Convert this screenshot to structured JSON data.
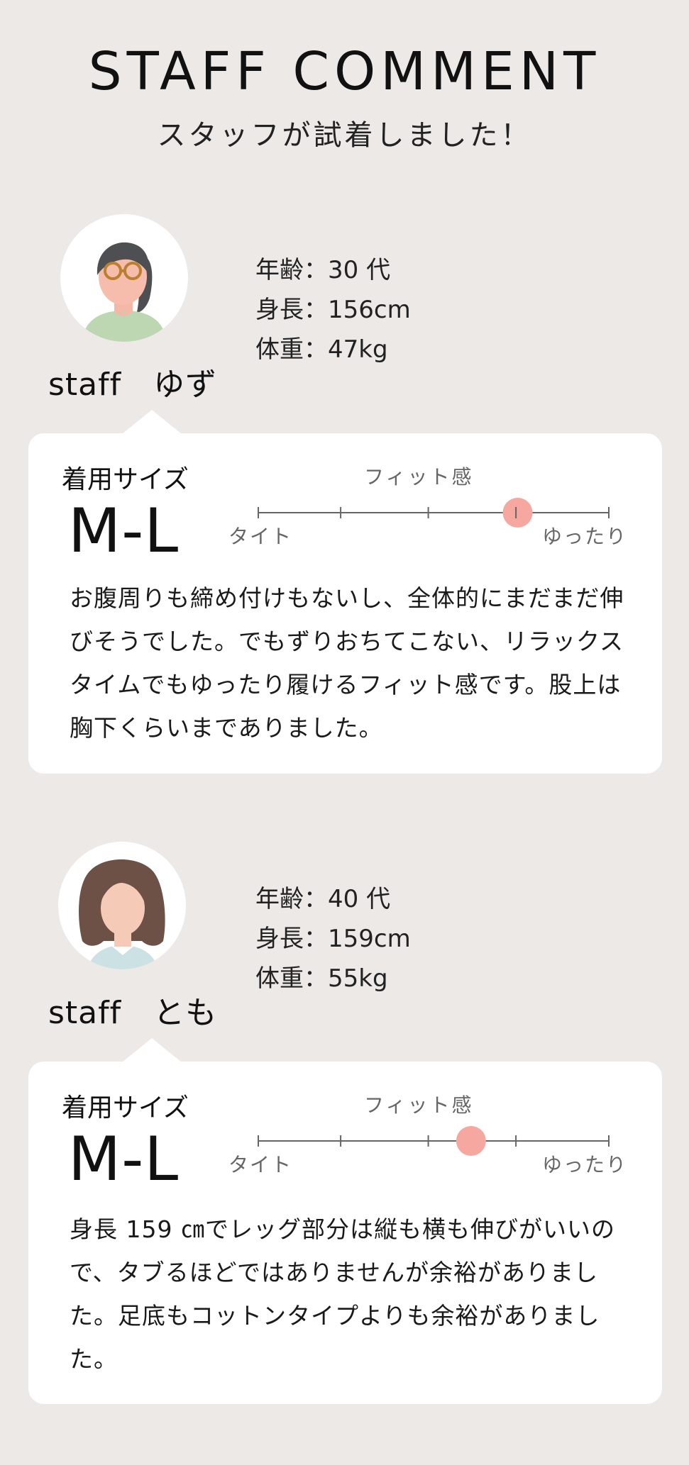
{
  "header": {
    "title": "STAFF COMMENT",
    "subtitle": "スタッフが試着しました！"
  },
  "colors": {
    "background": "#ece9e7",
    "card": "#ffffff",
    "fit_marker": "#f5a7a0",
    "scale_line": "#666666"
  },
  "staff": [
    {
      "name": "staff　ゆず",
      "avatar_icon": "woman-glasses-ponytail-icon",
      "age": "年齢：30 代",
      "height": "身長：156cm",
      "weight": "体重：47kg",
      "size_label": "着用サイズ",
      "size_value": "M-L",
      "fit_title": "フィット感",
      "fit_left": "タイト",
      "fit_right": "ゆったり",
      "fit_position": 0.74,
      "comment": "お腹周りも締め付けもないし、全体的にまだまだ伸びそうでした。でもずりおちてこない、リラックスタイムでもゆったり履けるフィット感です。股上は胸下くらいまでありました。"
    },
    {
      "name": "staff　とも",
      "avatar_icon": "woman-long-hair-icon",
      "age": "年齢：40 代",
      "height": "身長：159cm",
      "weight": "体重：55kg",
      "size_label": "着用サイズ",
      "size_value": "M-L",
      "fit_title": "フィット感",
      "fit_left": "タイト",
      "fit_right": "ゆったり",
      "fit_position": 0.607,
      "comment": "身長 159 ㎝でレッグ部分は縦も横も伸びがいいので、タブるほどではありませんが余裕がありました。足底もコットンタイプよりも余裕がありました。"
    }
  ]
}
